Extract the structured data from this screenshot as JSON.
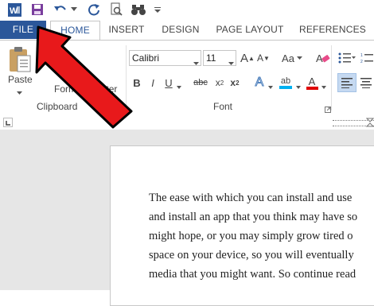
{
  "qat": {
    "app_icon": "word-app-icon",
    "save_icon": "save-icon",
    "undo_icon": "undo-icon",
    "redo_icon": "redo-icon",
    "preview_icon": "print-preview-icon",
    "find_icon": "binoculars-icon",
    "customize_icon": "chevron-down-icon"
  },
  "tabs": {
    "file": "FILE",
    "home": "HOME",
    "insert": "INSERT",
    "design": "DESIGN",
    "page_layout": "PAGE LAYOUT",
    "references": "REFERENCES"
  },
  "ribbon": {
    "clipboard": {
      "paste_label": "Paste",
      "format_painter_label": "Format Painter",
      "group_label": "Clipboard"
    },
    "font": {
      "font_name": "Calibri",
      "font_size": "11",
      "grow_label": "A",
      "shrink_label": "A",
      "case_label": "Aa",
      "bold": "B",
      "italic": "I",
      "underline": "U",
      "strike": "abc",
      "subscript": "x",
      "subscript_sub": "2",
      "superscript": "x",
      "superscript_sup": "2",
      "text_effects": "A",
      "highlight_label": "ab",
      "font_color_label": "A",
      "group_label": "Font"
    }
  },
  "colors": {
    "file_tab": "#2b579a",
    "arrow": "#e8191b",
    "highlight": "#00b0f0",
    "font_color": "#e00000"
  },
  "document": {
    "lines": [
      "The ease with which you can install and use",
      "and install an app that you think may have so",
      "might hope, or you may simply grow tired o",
      "space on your device, so you will eventually",
      "media that you might want. So continue read"
    ]
  }
}
